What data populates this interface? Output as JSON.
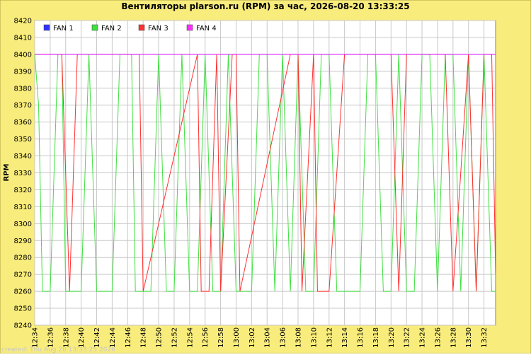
{
  "chart_data": {
    "type": "line",
    "title": "Вентиляторы plarson.ru (RPM) за час, 2026-08-20 13:33:25",
    "xlabel": "",
    "ylabel": "RPM",
    "ylim": [
      8240,
      8420
    ],
    "yticks": [
      8240,
      8250,
      8260,
      8270,
      8280,
      8290,
      8300,
      8310,
      8320,
      8330,
      8340,
      8350,
      8360,
      8370,
      8380,
      8390,
      8400,
      8410,
      8420
    ],
    "x_ticks": [
      "12:34",
      "12:36",
      "12:38",
      "12:40",
      "12:42",
      "12:44",
      "12:46",
      "12:48",
      "12:50",
      "12:52",
      "12:54",
      "12:56",
      "12:58",
      "13:00",
      "13:02",
      "13:04",
      "13:06",
      "13:08",
      "13:10",
      "13:12",
      "13:14",
      "13:16",
      "13:18",
      "13:20",
      "13:22",
      "13:24",
      "13:26",
      "13:28",
      "13:30",
      "13:32"
    ],
    "x_minutes": [
      0,
      2,
      4,
      6,
      8,
      10,
      12,
      14,
      16,
      18,
      20,
      22,
      24,
      26,
      28,
      30,
      32,
      34,
      36,
      38,
      40,
      42,
      44,
      46,
      48,
      50,
      52,
      54,
      56,
      58
    ],
    "x_range": [
      0,
      59.5
    ],
    "grid": true,
    "legend_position": "top-left",
    "colors": {
      "background": "#f8ec7c",
      "plot_bg": "#ffffff",
      "grid": "#c8c8c8"
    },
    "series": [
      {
        "name": "FAN 1",
        "color": "#3030ff",
        "x": [
          0,
          59.5
        ],
        "y": [
          8400,
          8400
        ]
      },
      {
        "name": "FAN 2",
        "color": "#40e040",
        "x": [
          0,
          0.5,
          1,
          2,
          3,
          3.5,
          4,
          5,
          6,
          7,
          8,
          9,
          10,
          11,
          12,
          12.5,
          13,
          14,
          15,
          16,
          17,
          18,
          19,
          20,
          21,
          22,
          23,
          24,
          25,
          26,
          27,
          28,
          29,
          30,
          31,
          32,
          33,
          34,
          35,
          36,
          37,
          38,
          39,
          40,
          41,
          42,
          43,
          44,
          45,
          46,
          47,
          48,
          49,
          50,
          51,
          52,
          53,
          54,
          55,
          56,
          57,
          58,
          59,
          59.5
        ],
        "y": [
          8400,
          8370,
          8260,
          8260,
          8400,
          8400,
          8260,
          8260,
          8260,
          8400,
          8260,
          8260,
          8260,
          8400,
          8400,
          8400,
          8260,
          8260,
          8260,
          8400,
          8260,
          8260,
          8400,
          8260,
          8260,
          8400,
          8260,
          8260,
          8400,
          8260,
          8260,
          8260,
          8400,
          8400,
          8260,
          8400,
          8260,
          8400,
          8260,
          8260,
          8400,
          8400,
          8260,
          8260,
          8260,
          8260,
          8400,
          8400,
          8260,
          8260,
          8400,
          8260,
          8260,
          8400,
          8400,
          8260,
          8400,
          8400,
          8260,
          8400,
          8260,
          8400,
          8260,
          8260
        ]
      },
      {
        "name": "FAN 3",
        "color": "#ff3030",
        "x": [
          0,
          3.5,
          4.5,
          5.5,
          13,
          13.5,
          14,
          21,
          21.5,
          22.5,
          23.5,
          24,
          25.5,
          26,
          26.5,
          33,
          34,
          34.5,
          36,
          36.5,
          37,
          38,
          40,
          46,
          47,
          48,
          53,
          54,
          56,
          57,
          58,
          59,
          59.5
        ],
        "y": [
          8400,
          8400,
          8260,
          8400,
          8400,
          8400,
          8260,
          8400,
          8260,
          8260,
          8400,
          8260,
          8400,
          8400,
          8260,
          8400,
          8400,
          8260,
          8400,
          8260,
          8260,
          8260,
          8400,
          8400,
          8260,
          8400,
          8400,
          8260,
          8400,
          8260,
          8400,
          8400,
          8270
        ]
      },
      {
        "name": "FAN 4",
        "color": "#ff30ff",
        "x": [
          0,
          59.5
        ],
        "y": [
          8400,
          8400
        ]
      }
    ],
    "watermark": "created: Thu Aug 20 13:33:25 2026"
  }
}
